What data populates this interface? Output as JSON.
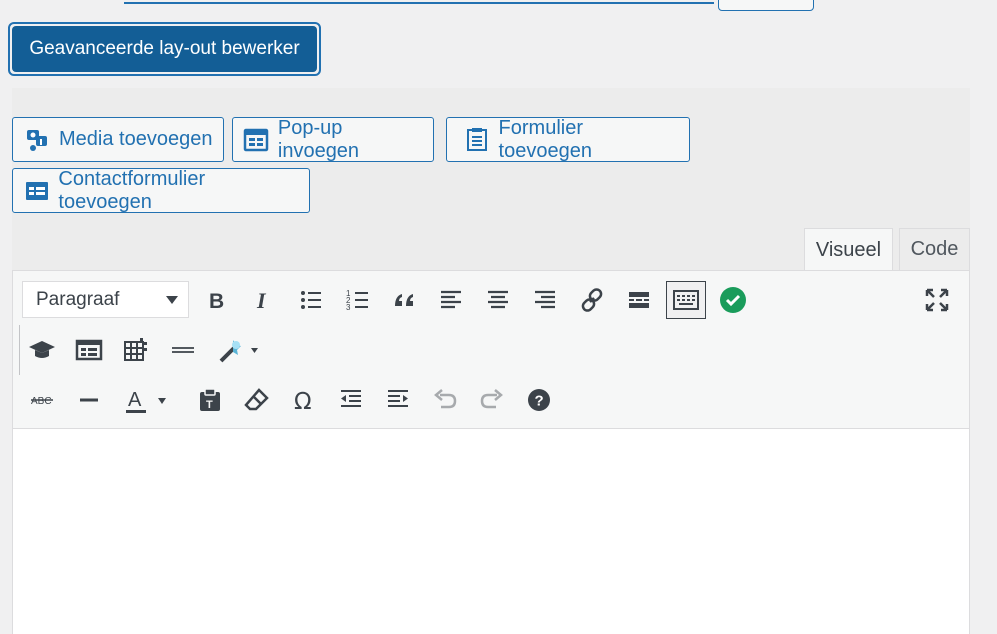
{
  "advanced_layout_button": "Geavanceerde lay-out bewerker",
  "media_buttons": {
    "add_media": "Media toevoegen",
    "insert_popup": "Pop-up invoegen",
    "add_form": "Formulier toevoegen",
    "contact_form": "Contactformulier toevoegen"
  },
  "tabs": {
    "visual": "Visueel",
    "code": "Code"
  },
  "toolbar": {
    "format_select": "Paragraaf",
    "icons": [
      "bold-icon",
      "italic-icon",
      "bulleted-list-icon",
      "numbered-list-icon",
      "blockquote-icon",
      "align-left-icon",
      "align-center-icon",
      "align-right-icon",
      "insert-link-icon",
      "read-more-icon",
      "toolbar-toggle-icon",
      "check-circle-icon",
      "fullscreen-icon",
      "graduation-cap-icon",
      "form-icon",
      "table-icon",
      "horizontal-rule-icon",
      "magic-wand-icon",
      "strikethrough-icon",
      "hr-line-icon",
      "text-color-icon",
      "paste-text-icon",
      "eraser-icon",
      "omega-icon",
      "outdent-icon",
      "indent-icon",
      "undo-icon",
      "redo-icon",
      "help-icon"
    ]
  },
  "colors": {
    "primary": "#2271b1",
    "primary_dark": "#135e96",
    "check_green": "#1a9c5b",
    "icon_dark": "#3c434a"
  }
}
